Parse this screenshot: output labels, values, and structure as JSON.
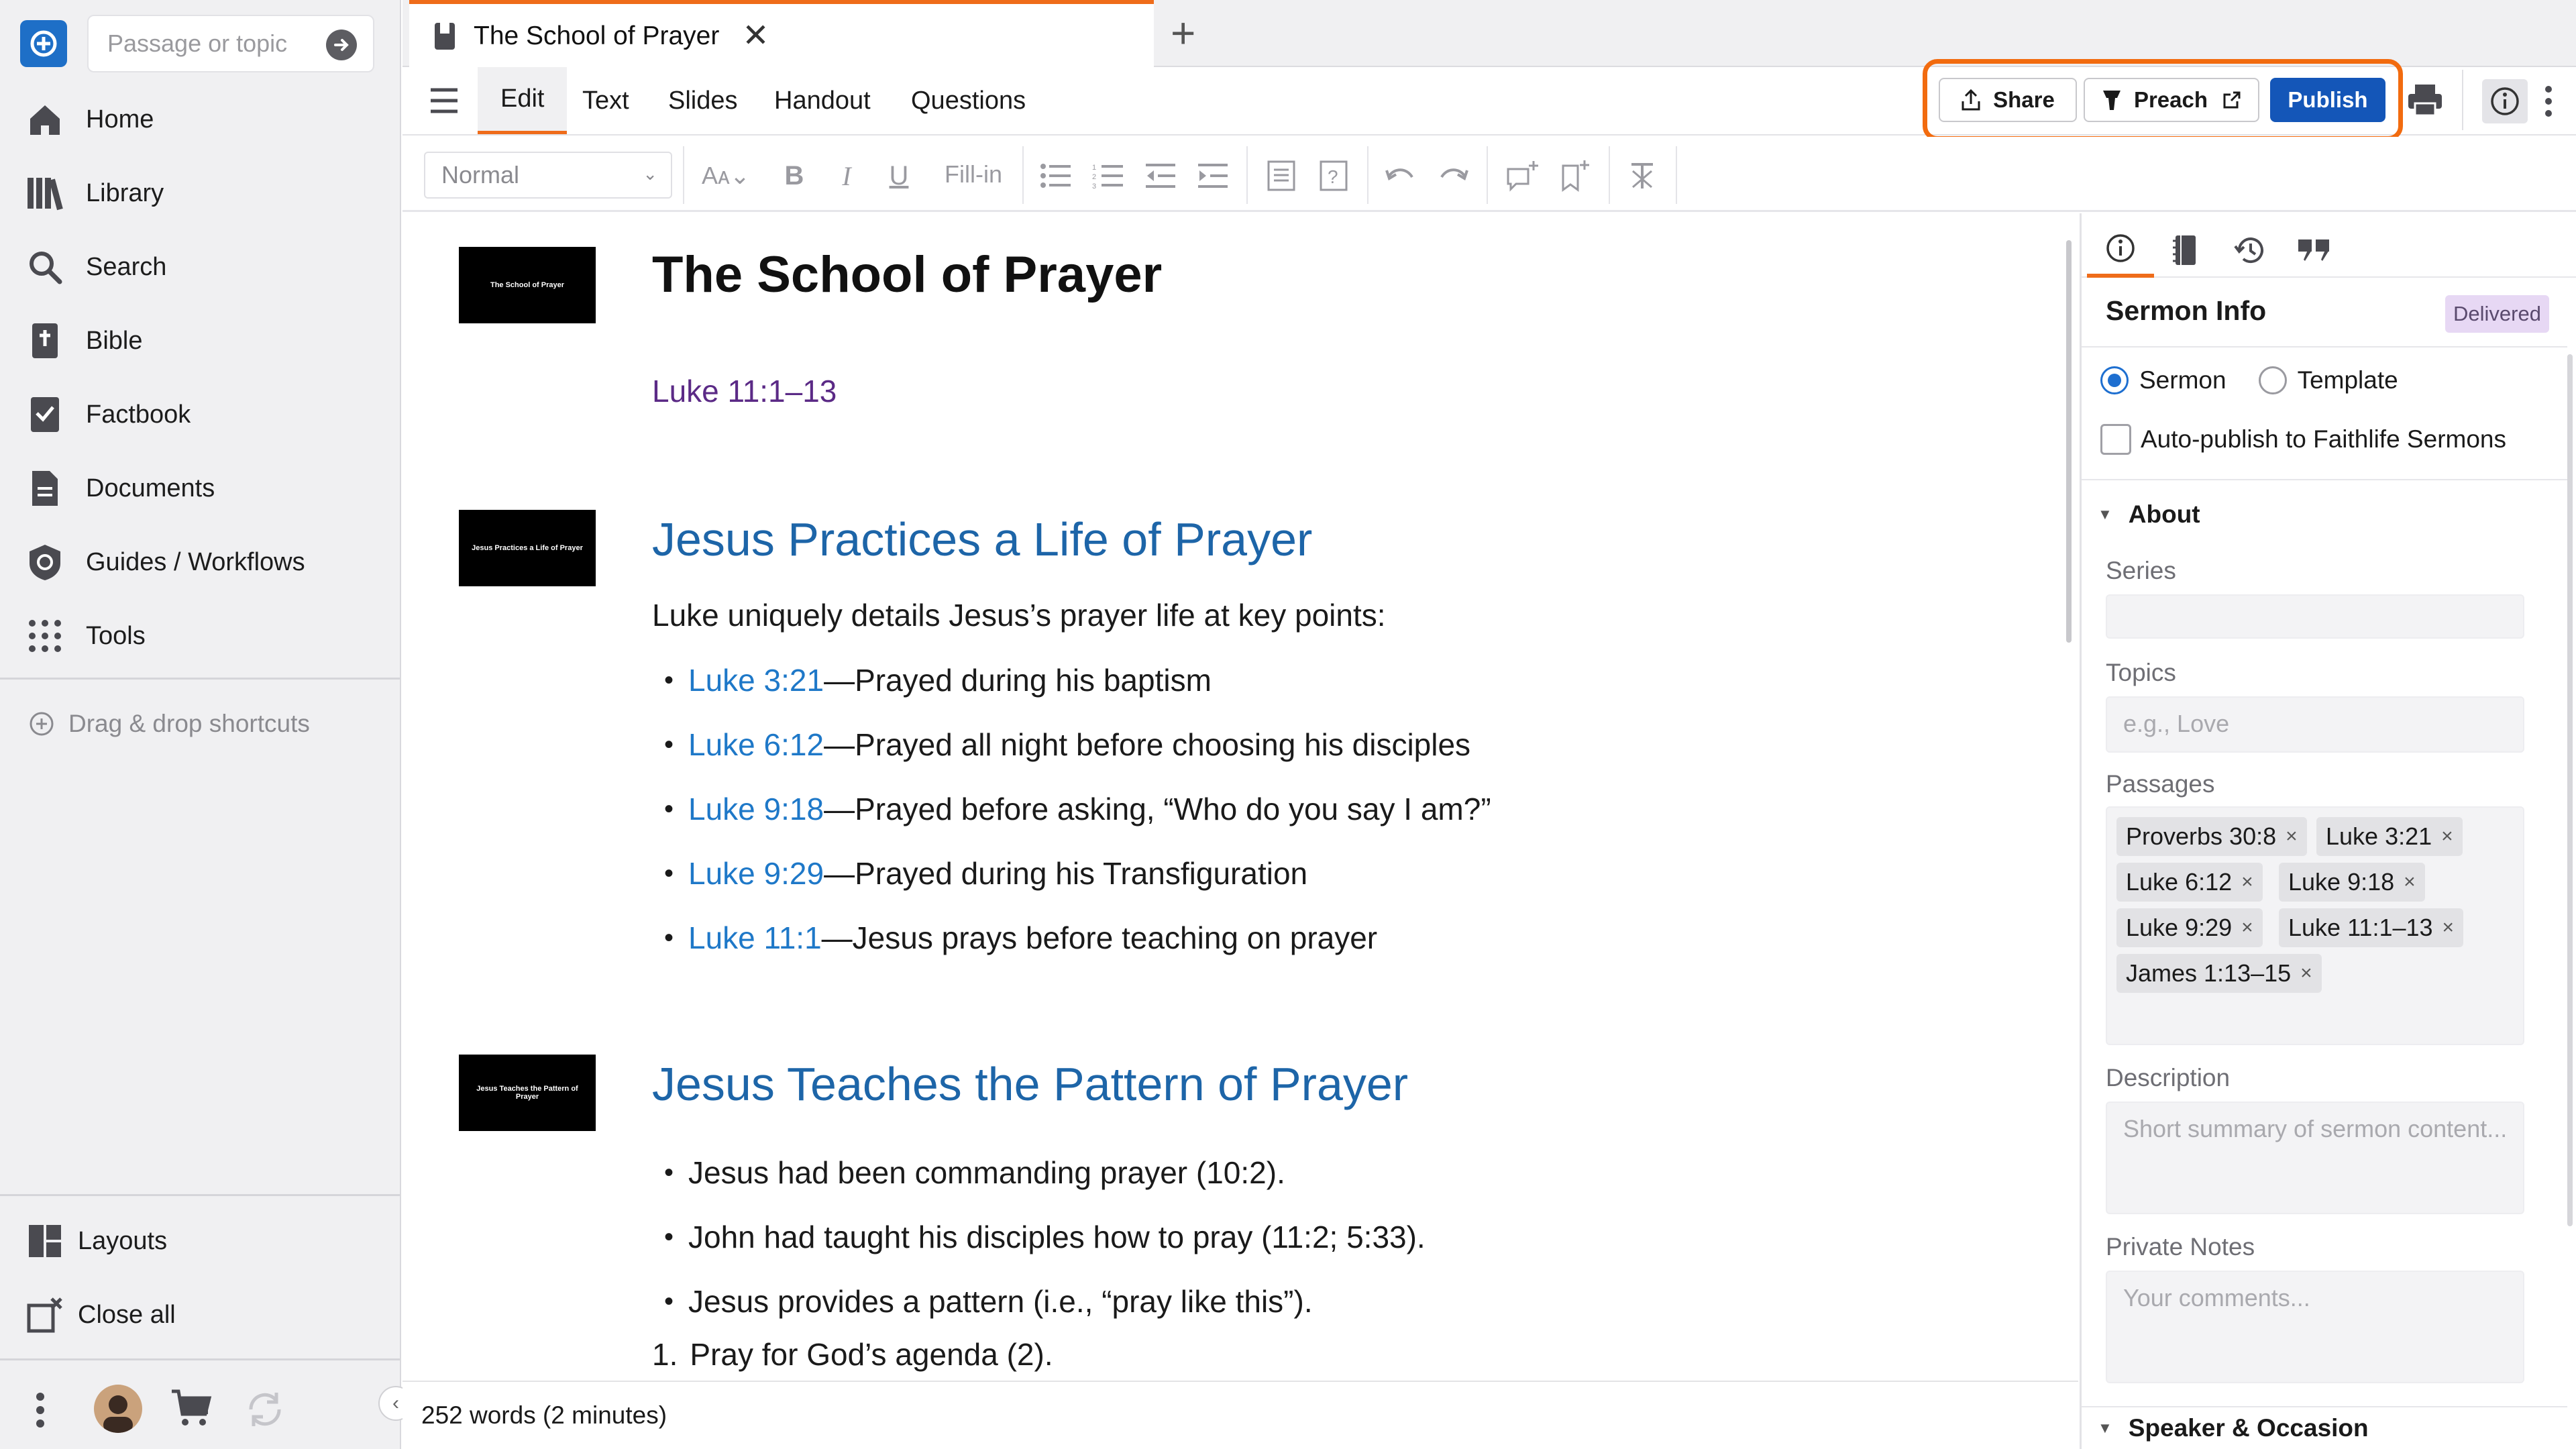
{
  "sidebar": {
    "search_placeholder": "Passage or topic",
    "items": [
      {
        "label": "Home",
        "icon": "home-icon"
      },
      {
        "label": "Library",
        "icon": "library-icon"
      },
      {
        "label": "Search",
        "icon": "search-icon"
      },
      {
        "label": "Bible",
        "icon": "bible-icon"
      },
      {
        "label": "Factbook",
        "icon": "factbook-icon"
      },
      {
        "label": "Documents",
        "icon": "documents-icon"
      },
      {
        "label": "Guides / Workflows",
        "icon": "guides-icon"
      },
      {
        "label": "Tools",
        "icon": "tools-icon"
      }
    ],
    "drag_hint": "Drag & drop shortcuts",
    "bottom_items": [
      {
        "label": "Layouts",
        "icon": "layouts-icon"
      },
      {
        "label": "Close all",
        "icon": "close-all-icon"
      }
    ]
  },
  "tab": {
    "title": "The School of Prayer",
    "close": "✕",
    "new": "+"
  },
  "menu": {
    "tabs": [
      "Edit",
      "Text",
      "Slides",
      "Handout",
      "Questions"
    ],
    "share_label": "Share",
    "preach_label": "Preach",
    "publish_label": "Publish"
  },
  "toolbar": {
    "style_value": "Normal",
    "fillin_label": "Fill-in"
  },
  "document": {
    "title": "The School of Prayer",
    "passage": "Luke 11:1–13",
    "thumb1": "The School of Prayer",
    "section1": {
      "thumb": "Jesus Practices a Life of Prayer",
      "heading": "Jesus Practices a Life of Prayer",
      "intro": "Luke uniquely details Jesus’s prayer life at key points:",
      "bullets": [
        {
          "ref": "Luke 3:21",
          "text": "—Prayed during his baptism"
        },
        {
          "ref": "Luke 6:12",
          "text": "—Prayed all night before choosing his disciples"
        },
        {
          "ref": "Luke 9:18",
          "text": "—Prayed before asking, “Who do you say I am?”"
        },
        {
          "ref": "Luke 9:29",
          "text": "—Prayed during his Transfiguration"
        },
        {
          "ref": "Luke 11:1",
          "text": "—Jesus prays before teaching on prayer"
        }
      ]
    },
    "section2": {
      "thumb": "Jesus Teaches the Pattern of Prayer",
      "heading": "Jesus Teaches the Pattern of Prayer",
      "bullets": [
        "Jesus had been commanding prayer (10:2).",
        "John had taught his disciples how to pray (11:2; 5:33).",
        "Jesus provides a pattern (i.e., “pray like this”)."
      ],
      "numbered_first": "1.",
      "numbered_text": "Pray for God’s agenda (2)."
    }
  },
  "status": {
    "word_count": "252 words (2 minutes)"
  },
  "panel": {
    "title": "Sermon Info",
    "badge": "Delivered",
    "radio_sermon": "Sermon",
    "radio_template": "Template",
    "autopublish": "Auto-publish to Faithlife Sermons",
    "about_heading": "About",
    "series_label": "Series",
    "topics_label": "Topics",
    "topics_placeholder": "e.g., Love",
    "passages_label": "Passages",
    "passages": [
      "Proverbs 30:8",
      "Luke 3:21",
      "Luke 6:12",
      "Luke 9:18",
      "Luke 9:29",
      "Luke 11:1–13",
      "James 1:13–15"
    ],
    "description_label": "Description",
    "description_placeholder": "Short summary of sermon content...",
    "notes_label": "Private Notes",
    "notes_placeholder": "Your comments...",
    "speaker_heading": "Speaker & Occasion"
  },
  "colors": {
    "accent": "#ef6c1a",
    "primary": "#1456b8",
    "link": "#1e78c8",
    "heading": "#1d65a8",
    "passage": "#5b2a86"
  }
}
